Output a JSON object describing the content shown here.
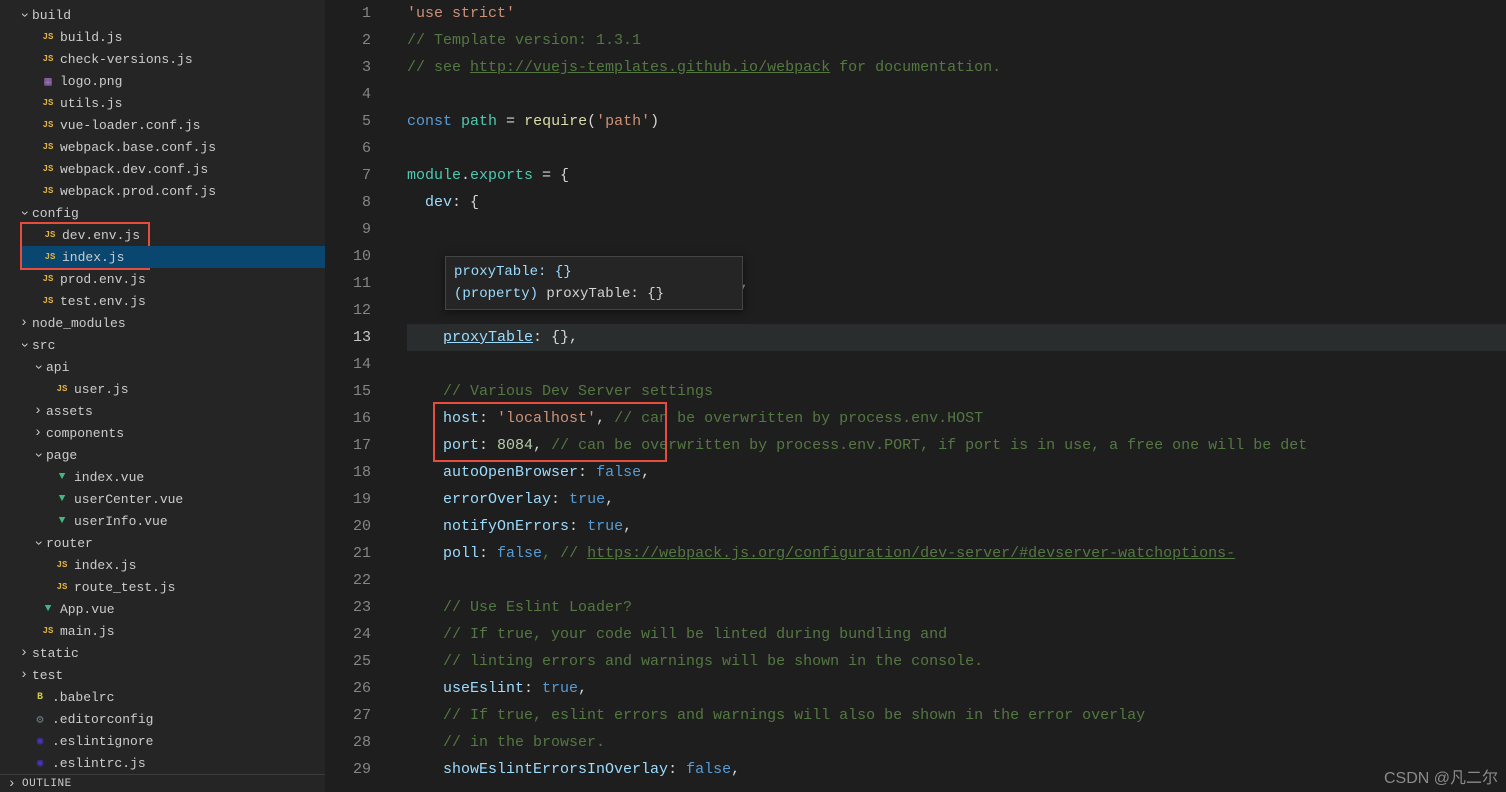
{
  "sidebar": {
    "folders": {
      "build": "build",
      "config": "config",
      "node_modules": "node_modules",
      "src": "src",
      "api": "api",
      "assets": "assets",
      "components": "components",
      "page": "page",
      "router": "router",
      "static": "static",
      "test": "test"
    },
    "files": {
      "build_js": "build.js",
      "check_versions": "check-versions.js",
      "logo": "logo.png",
      "utils": "utils.js",
      "vue_loader": "vue-loader.conf.js",
      "webpack_base": "webpack.base.conf.js",
      "webpack_dev": "webpack.dev.conf.js",
      "webpack_prod": "webpack.prod.conf.js",
      "dev_env": "dev.env.js",
      "index_js": "index.js",
      "prod_env": "prod.env.js",
      "test_env": "test.env.js",
      "user_js": "user.js",
      "index_vue": "index.vue",
      "usercenter": "userCenter.vue",
      "userinfo": "userInfo.vue",
      "router_index": "index.js",
      "route_test": "route_test.js",
      "app_vue": "App.vue",
      "main_js": "main.js",
      "babelrc": ".babelrc",
      "editorconfig": ".editorconfig",
      "eslintignore": ".eslintignore",
      "eslintrc": ".eslintrc.js"
    },
    "outline": "OUTLINE"
  },
  "tooltip": {
    "line1": "proxyTable: {}",
    "line2_a": "(property) ",
    "line2_b": "proxyTable: {}"
  },
  "code": {
    "l1": "'use strict'",
    "l2": "// Template version: 1.3.1",
    "l3a": "// see ",
    "l3b": "http://vuejs-templates.github.io/webpack",
    "l3c": " for documentation.",
    "l5_const": "const",
    "l5_path": "path",
    "l5_eq": " = ",
    "l5_req": "require",
    "l5_arg": "('path')",
    "l7_mod": "module",
    "l7_dot": ".",
    "l7_exp": "exports",
    "l7_rest": " = {",
    "l8_dev": "dev",
    "l8_rest": ": {",
    "l11_rest": "',",
    "l13_prop": "proxyTable",
    "l13_rest": ": {},",
    "l15": "// Various Dev Server settings",
    "l16_host": "host",
    "l16_c": ": ",
    "l16_val": "'localhost'",
    "l16_com": ", ",
    "l16_cmt": "// can be overwritten by process.env.HOST",
    "l17_port": "port",
    "l17_c": ": ",
    "l17_val": "8084",
    "l17_com": ", ",
    "l17_cmt": "// can be overwritten by process.env.PORT, if port is in use, a free one will be det",
    "l18_k": "autoOpenBrowser",
    "l18_v": "false",
    "l19_k": "errorOverlay",
    "l19_v": "true",
    "l20_k": "notifyOnErrors",
    "l20_v": "true",
    "l21_k": "poll",
    "l21_v": "false",
    "l21_cmt_a": ", // ",
    "l21_cmt_b": "https://webpack.js.org/configuration/dev-server/#devserver-watchoptions-",
    "l23": "// Use Eslint Loader?",
    "l24": "// If true, your code will be linted during bundling and",
    "l25": "// linting errors and warnings will be shown in the console.",
    "l26_k": "useEslint",
    "l26_v": "true",
    "l27": "// If true, eslint errors and warnings will also be shown in the error overlay",
    "l28": "// in the browser.",
    "l29_k": "showEslintErrorsInOverlay",
    "l29_v": "false"
  },
  "line_numbers": [
    "1",
    "2",
    "3",
    "4",
    "5",
    "6",
    "7",
    "8",
    "9",
    "10",
    "11",
    "12",
    "13",
    "14",
    "15",
    "16",
    "17",
    "18",
    "19",
    "20",
    "21",
    "22",
    "23",
    "24",
    "25",
    "26",
    "27",
    "28",
    "29"
  ],
  "watermark": "CSDN @凡二尔"
}
